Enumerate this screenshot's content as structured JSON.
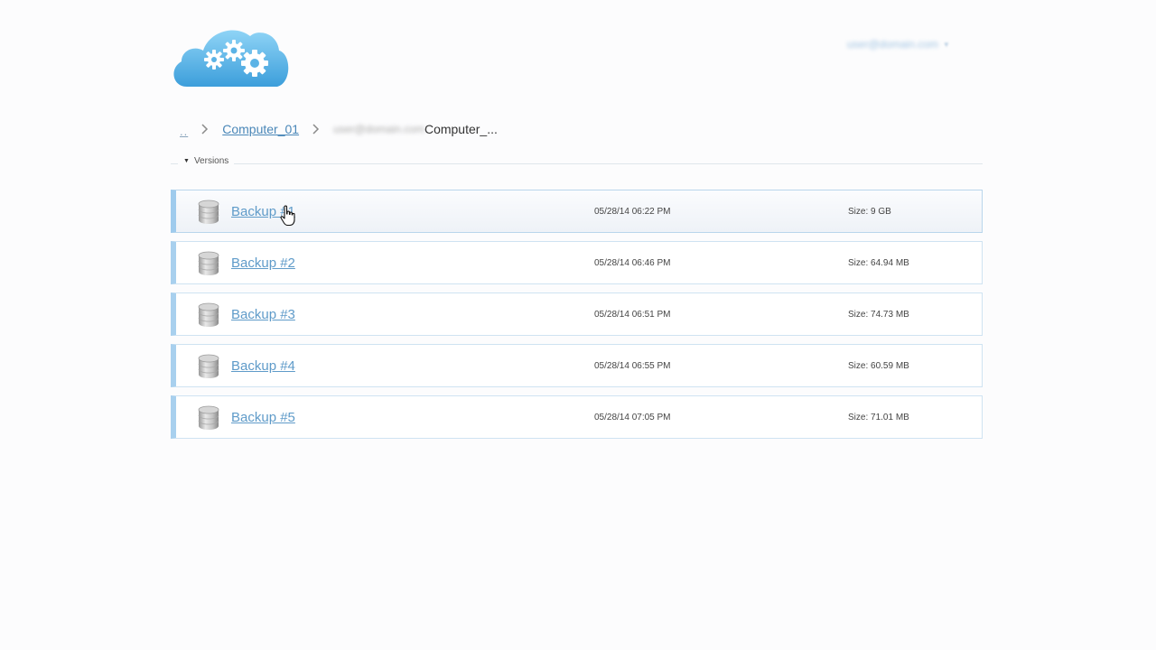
{
  "header": {
    "logo_alt": "cloud-gears-logo",
    "user_menu_text": "user@domain.com"
  },
  "breadcrumb": {
    "root": "..",
    "computer": "Computer_01",
    "hidden_prefix": "user@domain.com",
    "current": "Computer_..."
  },
  "section": {
    "label": "Versions"
  },
  "versions": [
    {
      "name": "Backup #1",
      "date": "05/28/14 06:22 PM",
      "size": "Size: 9 GB"
    },
    {
      "name": "Backup #2",
      "date": "05/28/14 06:46 PM",
      "size": "Size: 64.94 MB"
    },
    {
      "name": "Backup #3",
      "date": "05/28/14 06:51 PM",
      "size": "Size: 74.73 MB"
    },
    {
      "name": "Backup #4",
      "date": "05/28/14 06:55 PM",
      "size": "Size: 60.59 MB"
    },
    {
      "name": "Backup #5",
      "date": "05/28/14 07:05 PM",
      "size": "Size: 71.01 MB"
    }
  ],
  "colors": {
    "accent": "#a8d0ee",
    "link": "#5f9bc9",
    "cloud_light": "#8fd0f3",
    "cloud_dark": "#3e9fda"
  },
  "icons": {
    "logo": "cloud-with-gears",
    "row": "database-cylinder",
    "separator": "chevron-right",
    "section_toggle": "triangle-down",
    "pointer": "hand-cursor"
  }
}
